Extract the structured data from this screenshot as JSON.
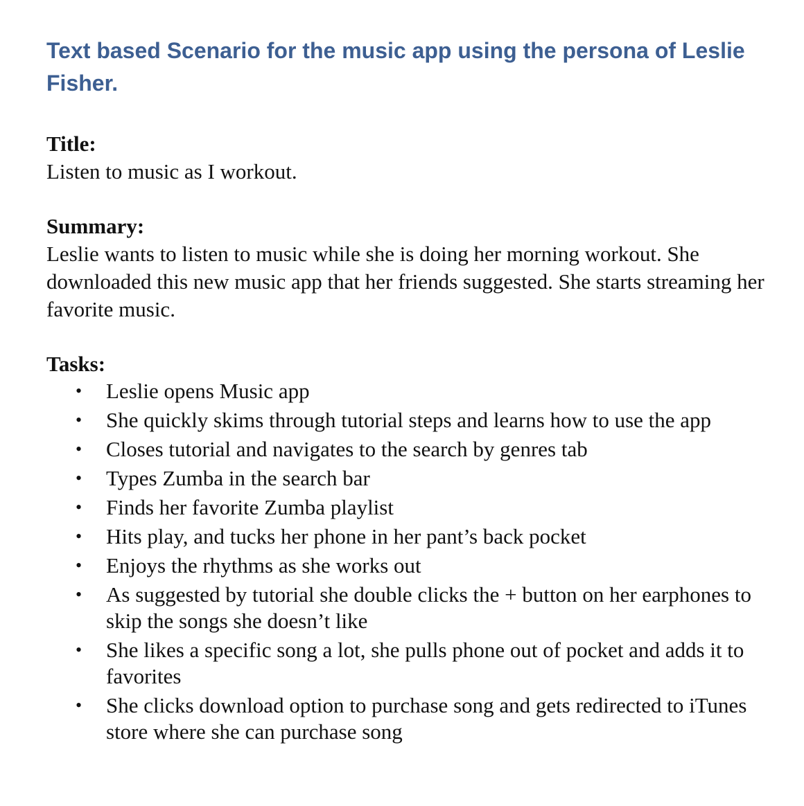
{
  "document": {
    "title": "Text based Scenario for the music app using the persona of Leslie Fisher.",
    "sections": {
      "title": {
        "heading": "Title:",
        "body": "Listen to music as I workout."
      },
      "summary": {
        "heading": "Summary:",
        "body": "Leslie wants to listen to music while she is doing her morning workout. She downloaded this new music app that her friends suggested. She starts streaming her favorite music."
      },
      "tasks": {
        "heading": "Tasks:",
        "bullet": "•",
        "items": [
          "Leslie opens Music app",
          "She quickly skims through tutorial steps and learns how to use the app",
          "Closes tutorial and navigates to the search by genres tab",
          "Types Zumba in the search bar",
          "Finds her favorite Zumba playlist",
          "Hits play, and tucks her phone in her pant’s back pocket",
          "Enjoys the rhythms as she works out",
          "As suggested by tutorial she double clicks the + button on her earphones to skip the songs she doesn’t like",
          "She likes a specific song a lot, she pulls phone out of pocket and adds it to favorites",
          "She clicks download option to purchase song and gets redirected to iTunes store where she can purchase song"
        ]
      }
    }
  },
  "colors": {
    "title": "#3d5f92",
    "text": "#111111",
    "background": "#ffffff"
  }
}
